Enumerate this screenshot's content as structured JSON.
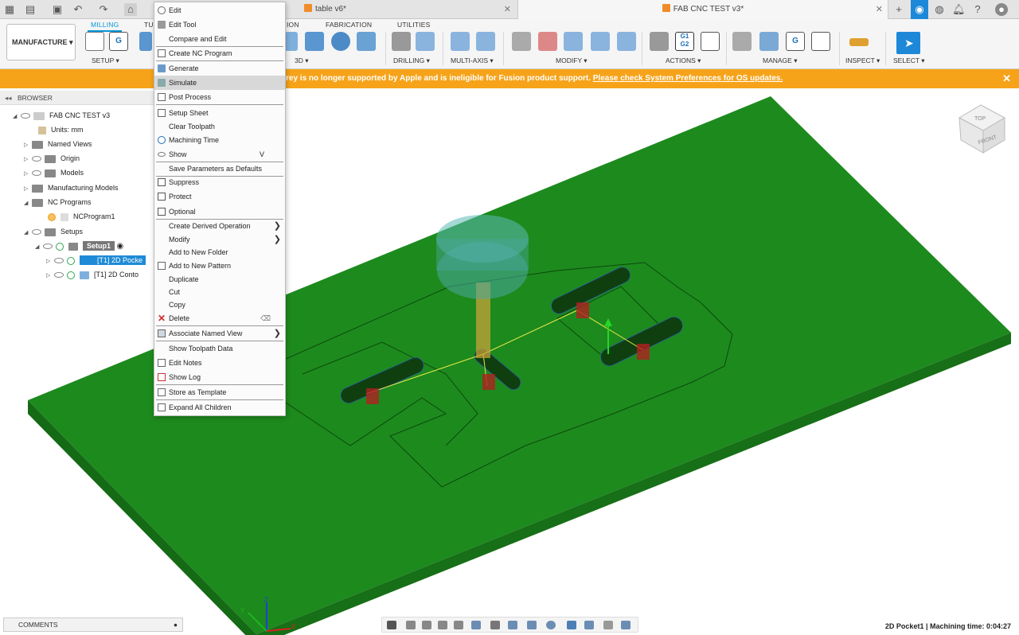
{
  "titlebar": {
    "tabs": [
      {
        "label": "table v6*"
      },
      {
        "label": "FAB CNC TEST v3*"
      }
    ]
  },
  "ribbon": {
    "workspace": "MANUFACTURE",
    "tabs": [
      "MILLING",
      "TU",
      "ION",
      "FABRICATION",
      "UTILITIES"
    ],
    "groups": [
      "SETUP ▾",
      "3D ▾",
      "DRILLING ▾",
      "MULTI-AXIS ▾",
      "MODIFY ▾",
      "ACTIONS ▾",
      "MANAGE ▾",
      "INSPECT ▾",
      "SELECT ▾"
    ],
    "accent": "#0696d7"
  },
  "banner": {
    "message": "rey is no longer supported by Apple and is ineligible for Fusion product support.",
    "link": "Please check System Preferences for OS updates.",
    "color": "#f6a31a"
  },
  "browser": {
    "title": "BROWSER",
    "rows": [
      {
        "label": "FAB CNC TEST v3"
      },
      {
        "label": "Units: mm"
      },
      {
        "label": "Named Views"
      },
      {
        "label": "Origin"
      },
      {
        "label": "Models"
      },
      {
        "label": "Manufacturing Models"
      },
      {
        "label": "NC Programs"
      },
      {
        "label": "NCProgram1"
      },
      {
        "label": "Setups"
      },
      {
        "label": "Setup1"
      },
      {
        "label": "[T1] 2D Pocke"
      },
      {
        "label": "[T1] 2D Conto"
      }
    ]
  },
  "context_menu": {
    "items": [
      {
        "label": "Edit",
        "icon": "gear-icon"
      },
      {
        "label": "Edit Tool",
        "icon": "tool-icon"
      },
      {
        "label": "Compare and Edit",
        "icon": ""
      },
      {
        "label": "Create NC Program",
        "icon": "nc-program-icon"
      },
      {
        "label": "Generate",
        "icon": "generate-icon"
      },
      {
        "label": "Simulate",
        "icon": "simulate-icon"
      },
      {
        "label": "Post Process",
        "icon": "post-process-icon"
      },
      {
        "label": "Setup Sheet",
        "icon": "setup-sheet-icon"
      },
      {
        "label": "Clear Toolpath",
        "icon": ""
      },
      {
        "label": "Machining Time",
        "icon": "clock-icon"
      },
      {
        "label": "Show",
        "icon": "eye-icon",
        "shortcut": "V"
      },
      {
        "label": "Save Parameters as Defaults",
        "icon": ""
      },
      {
        "label": "Suppress",
        "icon": "checkbox-icon"
      },
      {
        "label": "Protect",
        "icon": "checkbox-icon"
      },
      {
        "label": "Optional",
        "icon": "checkbox-icon"
      },
      {
        "label": "Create Derived Operation",
        "icon": ""
      },
      {
        "label": "Modify",
        "icon": ""
      },
      {
        "label": "Add to New Folder",
        "icon": ""
      },
      {
        "label": "Add to New Pattern",
        "icon": "pattern-icon"
      },
      {
        "label": "Duplicate",
        "icon": ""
      },
      {
        "label": "Cut",
        "icon": ""
      },
      {
        "label": "Copy",
        "icon": ""
      },
      {
        "label": "Delete",
        "icon": "delete-icon"
      },
      {
        "label": "Associate Named View",
        "icon": "named-view-icon"
      },
      {
        "label": "Show Toolpath Data",
        "icon": ""
      },
      {
        "label": "Edit Notes",
        "icon": "notes-icon"
      },
      {
        "label": "Show Log",
        "icon": "log-icon"
      },
      {
        "label": "Store as Template",
        "icon": "template-icon"
      },
      {
        "label": "Expand All Children",
        "icon": "expand-icon"
      }
    ],
    "highlighted": "Simulate"
  },
  "viewcube": {
    "top": "TOP",
    "front": "FRONT"
  },
  "axes": {
    "z": "Z",
    "y": "Y",
    "x": "X"
  },
  "comments": {
    "label": "COMMENTS"
  },
  "status": {
    "text": "2D Pocket1 | Machining time: 0:04:27"
  },
  "colors": {
    "stock": "#1d8a1d",
    "stock_side": "#156a15",
    "select": "#1e88d8"
  }
}
